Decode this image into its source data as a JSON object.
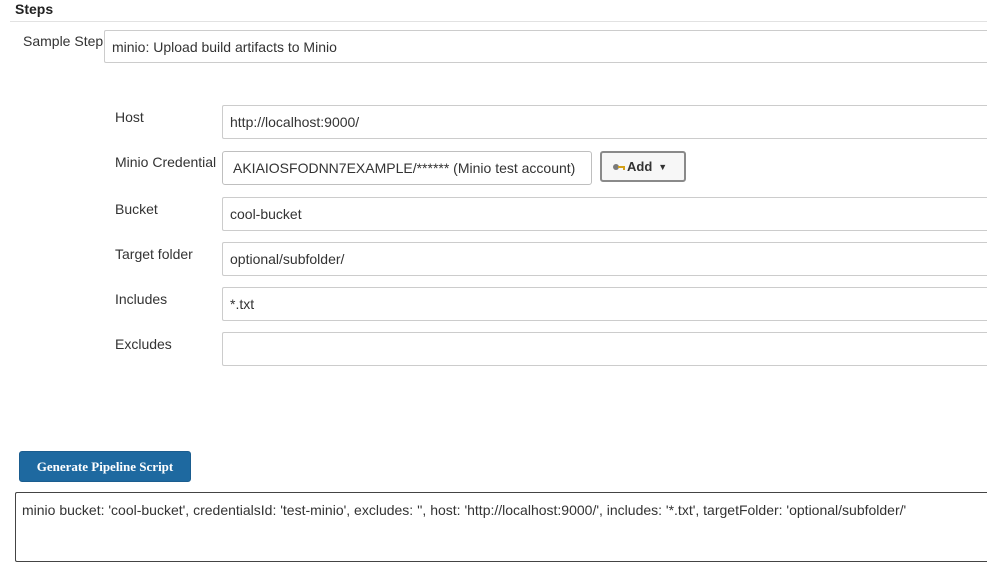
{
  "section": {
    "title": "Steps"
  },
  "sample_step": {
    "label": "Sample Step",
    "value": "minio: Upload build artifacts to Minio"
  },
  "form": {
    "host": {
      "label": "Host",
      "value": "http://localhost:9000/"
    },
    "credential": {
      "label": "Minio Credential",
      "value": "AKIAIOSFODNN7EXAMPLE/****** (Minio test account)",
      "add_label": "Add",
      "add_icon": "key-icon"
    },
    "bucket": {
      "label": "Bucket",
      "value": "cool-bucket"
    },
    "target_folder": {
      "label": "Target folder",
      "value": "optional/subfolder/"
    },
    "includes": {
      "label": "Includes",
      "value": "*.txt"
    },
    "excludes": {
      "label": "Excludes",
      "value": ""
    }
  },
  "generate": {
    "label": "Generate Pipeline Script"
  },
  "script": {
    "value": "minio bucket: 'cool-bucket', credentialsId: 'test-minio', excludes: '', host: 'http://localhost:9000/', includes: '*.txt', targetFolder: 'optional/subfolder/'"
  },
  "colors": {
    "primary_button": "#1e69a0",
    "border": "#cccccc"
  }
}
